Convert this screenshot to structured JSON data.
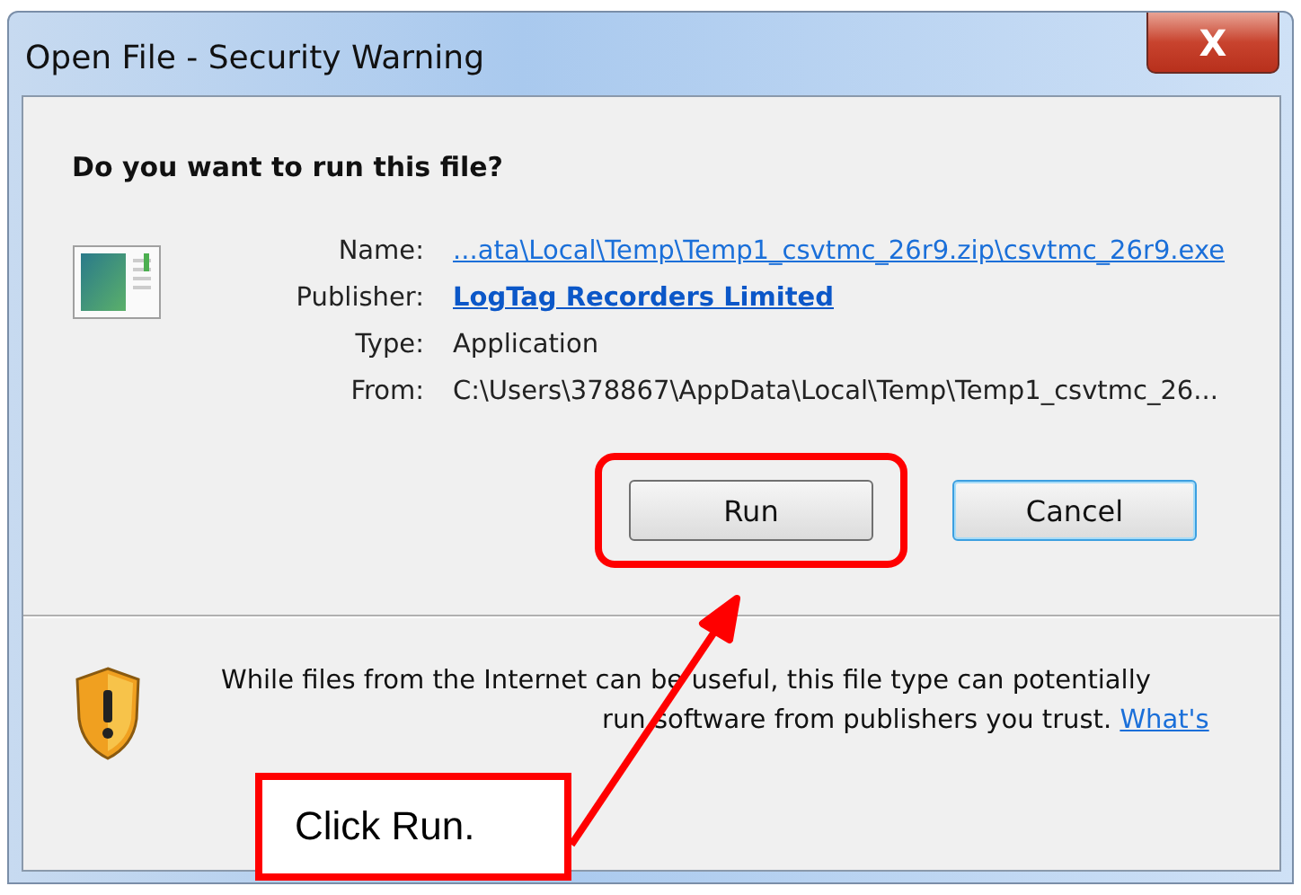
{
  "window": {
    "title": "Open File - Security Warning",
    "close_label": "X"
  },
  "question": "Do you want to run this file?",
  "details": [
    {
      "label": "Name:",
      "value": "...ata\\Local\\Temp\\Temp1_csvtmc_26r9.zip\\csvtmc_26r9.exe",
      "kind": "link"
    },
    {
      "label": "Publisher:",
      "value": "LogTag Recorders Limited",
      "kind": "bold-link"
    },
    {
      "label": "Type:",
      "value": "Application",
      "kind": "text"
    },
    {
      "label": "From:",
      "value": "C:\\Users\\378867\\AppData\\Local\\Temp\\Temp1_csvtmc_26...",
      "kind": "text"
    }
  ],
  "buttons": [
    {
      "label": "Run",
      "highlighted": true,
      "focused": false
    },
    {
      "label": "Cancel",
      "highlighted": false,
      "focused": true
    }
  ],
  "warning": {
    "line_1": "While files from the Internet can be useful, this file type can potentially",
    "line_2": "run software from publishers you trust.",
    "link": "What's"
  },
  "callout": {
    "text": "Click Run."
  }
}
